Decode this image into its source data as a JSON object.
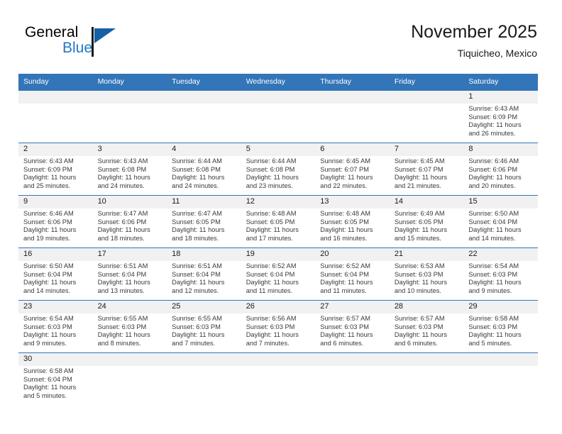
{
  "brand": {
    "name_part1": "General",
    "name_part2": "Blue",
    "mark": "triangle-logo"
  },
  "header": {
    "title": "November 2025",
    "subtitle": "Tiquicheo, Mexico"
  },
  "colors": {
    "header_blue": "#3275b8",
    "brand_blue": "#2277c8",
    "daynum_bg": "#f1f1f1",
    "row_rule": "#3275b8"
  },
  "weekdays": [
    "Sunday",
    "Monday",
    "Tuesday",
    "Wednesday",
    "Thursday",
    "Friday",
    "Saturday"
  ],
  "weeks": [
    [
      {
        "day": "",
        "sunrise": "",
        "sunset": "",
        "daylight1": "",
        "daylight2": "",
        "empty": true
      },
      {
        "day": "",
        "sunrise": "",
        "sunset": "",
        "daylight1": "",
        "daylight2": "",
        "empty": true
      },
      {
        "day": "",
        "sunrise": "",
        "sunset": "",
        "daylight1": "",
        "daylight2": "",
        "empty": true
      },
      {
        "day": "",
        "sunrise": "",
        "sunset": "",
        "daylight1": "",
        "daylight2": "",
        "empty": true
      },
      {
        "day": "",
        "sunrise": "",
        "sunset": "",
        "daylight1": "",
        "daylight2": "",
        "empty": true
      },
      {
        "day": "",
        "sunrise": "",
        "sunset": "",
        "daylight1": "",
        "daylight2": "",
        "empty": true
      },
      {
        "day": "1",
        "sunrise": "Sunrise: 6:43 AM",
        "sunset": "Sunset: 6:09 PM",
        "daylight1": "Daylight: 11 hours",
        "daylight2": "and 26 minutes.",
        "empty": false
      }
    ],
    [
      {
        "day": "2",
        "sunrise": "Sunrise: 6:43 AM",
        "sunset": "Sunset: 6:09 PM",
        "daylight1": "Daylight: 11 hours",
        "daylight2": "and 25 minutes.",
        "empty": false
      },
      {
        "day": "3",
        "sunrise": "Sunrise: 6:43 AM",
        "sunset": "Sunset: 6:08 PM",
        "daylight1": "Daylight: 11 hours",
        "daylight2": "and 24 minutes.",
        "empty": false
      },
      {
        "day": "4",
        "sunrise": "Sunrise: 6:44 AM",
        "sunset": "Sunset: 6:08 PM",
        "daylight1": "Daylight: 11 hours",
        "daylight2": "and 24 minutes.",
        "empty": false
      },
      {
        "day": "5",
        "sunrise": "Sunrise: 6:44 AM",
        "sunset": "Sunset: 6:08 PM",
        "daylight1": "Daylight: 11 hours",
        "daylight2": "and 23 minutes.",
        "empty": false
      },
      {
        "day": "6",
        "sunrise": "Sunrise: 6:45 AM",
        "sunset": "Sunset: 6:07 PM",
        "daylight1": "Daylight: 11 hours",
        "daylight2": "and 22 minutes.",
        "empty": false
      },
      {
        "day": "7",
        "sunrise": "Sunrise: 6:45 AM",
        "sunset": "Sunset: 6:07 PM",
        "daylight1": "Daylight: 11 hours",
        "daylight2": "and 21 minutes.",
        "empty": false
      },
      {
        "day": "8",
        "sunrise": "Sunrise: 6:46 AM",
        "sunset": "Sunset: 6:06 PM",
        "daylight1": "Daylight: 11 hours",
        "daylight2": "and 20 minutes.",
        "empty": false
      }
    ],
    [
      {
        "day": "9",
        "sunrise": "Sunrise: 6:46 AM",
        "sunset": "Sunset: 6:06 PM",
        "daylight1": "Daylight: 11 hours",
        "daylight2": "and 19 minutes.",
        "empty": false
      },
      {
        "day": "10",
        "sunrise": "Sunrise: 6:47 AM",
        "sunset": "Sunset: 6:06 PM",
        "daylight1": "Daylight: 11 hours",
        "daylight2": "and 18 minutes.",
        "empty": false
      },
      {
        "day": "11",
        "sunrise": "Sunrise: 6:47 AM",
        "sunset": "Sunset: 6:05 PM",
        "daylight1": "Daylight: 11 hours",
        "daylight2": "and 18 minutes.",
        "empty": false
      },
      {
        "day": "12",
        "sunrise": "Sunrise: 6:48 AM",
        "sunset": "Sunset: 6:05 PM",
        "daylight1": "Daylight: 11 hours",
        "daylight2": "and 17 minutes.",
        "empty": false
      },
      {
        "day": "13",
        "sunrise": "Sunrise: 6:48 AM",
        "sunset": "Sunset: 6:05 PM",
        "daylight1": "Daylight: 11 hours",
        "daylight2": "and 16 minutes.",
        "empty": false
      },
      {
        "day": "14",
        "sunrise": "Sunrise: 6:49 AM",
        "sunset": "Sunset: 6:05 PM",
        "daylight1": "Daylight: 11 hours",
        "daylight2": "and 15 minutes.",
        "empty": false
      },
      {
        "day": "15",
        "sunrise": "Sunrise: 6:50 AM",
        "sunset": "Sunset: 6:04 PM",
        "daylight1": "Daylight: 11 hours",
        "daylight2": "and 14 minutes.",
        "empty": false
      }
    ],
    [
      {
        "day": "16",
        "sunrise": "Sunrise: 6:50 AM",
        "sunset": "Sunset: 6:04 PM",
        "daylight1": "Daylight: 11 hours",
        "daylight2": "and 14 minutes.",
        "empty": false
      },
      {
        "day": "17",
        "sunrise": "Sunrise: 6:51 AM",
        "sunset": "Sunset: 6:04 PM",
        "daylight1": "Daylight: 11 hours",
        "daylight2": "and 13 minutes.",
        "empty": false
      },
      {
        "day": "18",
        "sunrise": "Sunrise: 6:51 AM",
        "sunset": "Sunset: 6:04 PM",
        "daylight1": "Daylight: 11 hours",
        "daylight2": "and 12 minutes.",
        "empty": false
      },
      {
        "day": "19",
        "sunrise": "Sunrise: 6:52 AM",
        "sunset": "Sunset: 6:04 PM",
        "daylight1": "Daylight: 11 hours",
        "daylight2": "and 11 minutes.",
        "empty": false
      },
      {
        "day": "20",
        "sunrise": "Sunrise: 6:52 AM",
        "sunset": "Sunset: 6:04 PM",
        "daylight1": "Daylight: 11 hours",
        "daylight2": "and 11 minutes.",
        "empty": false
      },
      {
        "day": "21",
        "sunrise": "Sunrise: 6:53 AM",
        "sunset": "Sunset: 6:03 PM",
        "daylight1": "Daylight: 11 hours",
        "daylight2": "and 10 minutes.",
        "empty": false
      },
      {
        "day": "22",
        "sunrise": "Sunrise: 6:54 AM",
        "sunset": "Sunset: 6:03 PM",
        "daylight1": "Daylight: 11 hours",
        "daylight2": "and 9 minutes.",
        "empty": false
      }
    ],
    [
      {
        "day": "23",
        "sunrise": "Sunrise: 6:54 AM",
        "sunset": "Sunset: 6:03 PM",
        "daylight1": "Daylight: 11 hours",
        "daylight2": "and 9 minutes.",
        "empty": false
      },
      {
        "day": "24",
        "sunrise": "Sunrise: 6:55 AM",
        "sunset": "Sunset: 6:03 PM",
        "daylight1": "Daylight: 11 hours",
        "daylight2": "and 8 minutes.",
        "empty": false
      },
      {
        "day": "25",
        "sunrise": "Sunrise: 6:55 AM",
        "sunset": "Sunset: 6:03 PM",
        "daylight1": "Daylight: 11 hours",
        "daylight2": "and 7 minutes.",
        "empty": false
      },
      {
        "day": "26",
        "sunrise": "Sunrise: 6:56 AM",
        "sunset": "Sunset: 6:03 PM",
        "daylight1": "Daylight: 11 hours",
        "daylight2": "and 7 minutes.",
        "empty": false
      },
      {
        "day": "27",
        "sunrise": "Sunrise: 6:57 AM",
        "sunset": "Sunset: 6:03 PM",
        "daylight1": "Daylight: 11 hours",
        "daylight2": "and 6 minutes.",
        "empty": false
      },
      {
        "day": "28",
        "sunrise": "Sunrise: 6:57 AM",
        "sunset": "Sunset: 6:03 PM",
        "daylight1": "Daylight: 11 hours",
        "daylight2": "and 6 minutes.",
        "empty": false
      },
      {
        "day": "29",
        "sunrise": "Sunrise: 6:58 AM",
        "sunset": "Sunset: 6:03 PM",
        "daylight1": "Daylight: 11 hours",
        "daylight2": "and 5 minutes.",
        "empty": false
      }
    ],
    [
      {
        "day": "30",
        "sunrise": "Sunrise: 6:58 AM",
        "sunset": "Sunset: 6:04 PM",
        "daylight1": "Daylight: 11 hours",
        "daylight2": "and 5 minutes.",
        "empty": false
      },
      {
        "day": "",
        "sunrise": "",
        "sunset": "",
        "daylight1": "",
        "daylight2": "",
        "empty": true
      },
      {
        "day": "",
        "sunrise": "",
        "sunset": "",
        "daylight1": "",
        "daylight2": "",
        "empty": true
      },
      {
        "day": "",
        "sunrise": "",
        "sunset": "",
        "daylight1": "",
        "daylight2": "",
        "empty": true
      },
      {
        "day": "",
        "sunrise": "",
        "sunset": "",
        "daylight1": "",
        "daylight2": "",
        "empty": true
      },
      {
        "day": "",
        "sunrise": "",
        "sunset": "",
        "daylight1": "",
        "daylight2": "",
        "empty": true
      },
      {
        "day": "",
        "sunrise": "",
        "sunset": "",
        "daylight1": "",
        "daylight2": "",
        "empty": true
      }
    ]
  ]
}
